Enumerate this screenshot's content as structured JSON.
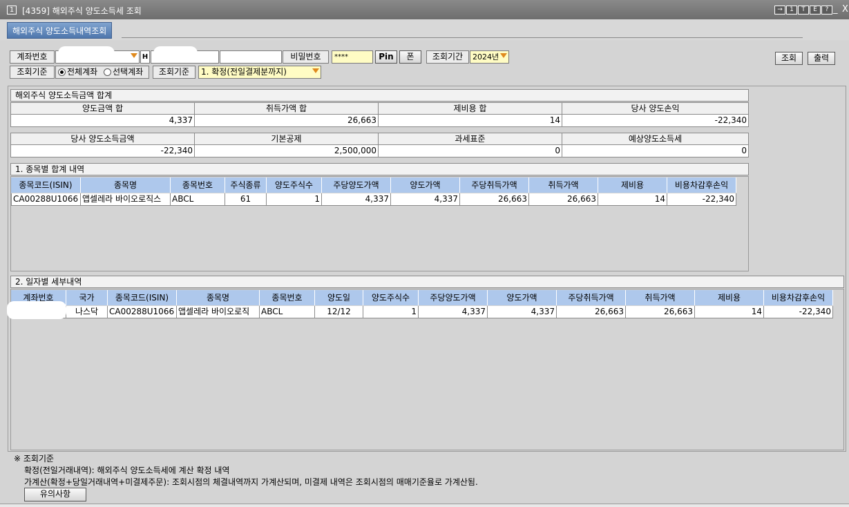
{
  "window": {
    "number": "1",
    "title": "[4359] 해외주식 양도소득세 조회",
    "title_buttons": [
      "→",
      "1",
      "T",
      "E",
      "?"
    ],
    "minimize": "_",
    "close": "X"
  },
  "tab": {
    "label": "해외주식 양도소득내역조회"
  },
  "search": {
    "account_label": "계좌번호",
    "h_marker": "H",
    "password_label": "비밀번호",
    "password_value": "****",
    "pin_button": "Pin",
    "phone_button": "폰",
    "period_label": "조회기간",
    "period_value": "2024년",
    "query_button": "조회",
    "print_button": "출력",
    "basis_label_1": "조회기준",
    "radio_all": "전체계좌",
    "radio_selected": "선택계좌",
    "basis_label_2": "조회기준",
    "basis_value": "1. 확정(전일결제분까지)"
  },
  "summary": {
    "title": "해외주식 양도소득금액 합계",
    "row1_headers": [
      "양도금액 합",
      "취득가액 합",
      "제비용 합",
      "당사 양도손익"
    ],
    "row1_values": [
      "4,337",
      "26,663",
      "14",
      "-22,340"
    ],
    "row2_headers": [
      "당사 양도소득금액",
      "기본공제",
      "과세표준",
      "예상양도소득세"
    ],
    "row2_values": [
      "-22,340",
      "2,500,000",
      "0",
      "0"
    ]
  },
  "by_stock": {
    "title": "1. 종목별 합계 내역",
    "columns": [
      "종목코드(ISIN)",
      "종목명",
      "종목번호",
      "주식종류",
      "양도주식수",
      "주당양도가액",
      "양도가액",
      "주당취득가액",
      "취득가액",
      "제비용",
      "비용차감후손익"
    ],
    "rows": [
      [
        "CA00288U1066",
        "앱셀레라 바이오로직스",
        "ABCL",
        "61",
        "1",
        "4,337",
        "4,337",
        "26,663",
        "26,663",
        "14",
        "-22,340"
      ]
    ]
  },
  "by_date": {
    "title": "2. 일자별 세부내역",
    "columns": [
      "계좌번호",
      "국가",
      "종목코드(ISIN)",
      "종목명",
      "종목번호",
      "양도일",
      "양도주식수",
      "주당양도가액",
      "양도가액",
      "주당취득가액",
      "취득가액",
      "제비용",
      "비용차감후손익"
    ],
    "rows": [
      [
        "",
        "나스닥",
        "CA00288U1066",
        "앱셀레라 바이오로직",
        "ABCL",
        "12/12",
        "1",
        "4,337",
        "4,337",
        "26,663",
        "26,663",
        "14",
        "-22,340"
      ]
    ]
  },
  "notes": {
    "heading": "※ 조회기준",
    "line1": "확정(전일거래내역): 해외주식  양도소득세에 계산 확정 내역",
    "line2": "가계산(확정+당일거래내역+미결제주문): 조회시점의 체결내역까지 가계산되며, 미결제 내역은 조회시점의 매매기준율로 가계산됨.",
    "caution_button": "유의사항"
  }
}
